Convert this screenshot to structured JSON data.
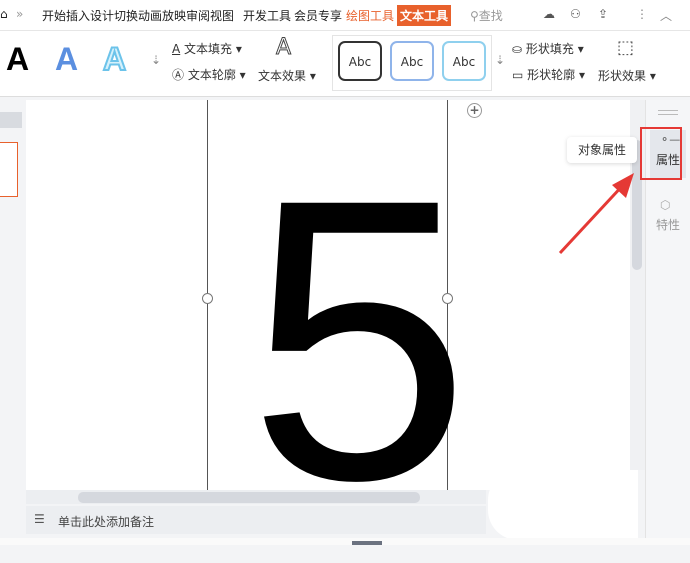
{
  "menu": {
    "tabs": [
      "开始",
      "插入",
      "设计",
      "切换",
      "动画",
      "放映",
      "审阅",
      "视图",
      "开发工具",
      "会员专享",
      "绘图工具",
      "文本工具"
    ],
    "search": "查找",
    "accent": "#e8612c"
  },
  "ribbon": {
    "text_fill": "文本填充",
    "text_outline": "文本轮廓",
    "text_effect": "文本效果",
    "shape_fill": "形状填充",
    "shape_outline": "形状轮廓",
    "shape_effect": "形状效果",
    "style_sample": "A",
    "abc": [
      "Abc",
      "Abc",
      "Abc"
    ]
  },
  "slide": {
    "text": "5"
  },
  "tooltip": "对象属性",
  "side_panel": {
    "properties": "属性",
    "traits": "特性"
  },
  "notes": {
    "placeholder": "单击此处添加备注"
  },
  "highlight_color": "#e53935"
}
